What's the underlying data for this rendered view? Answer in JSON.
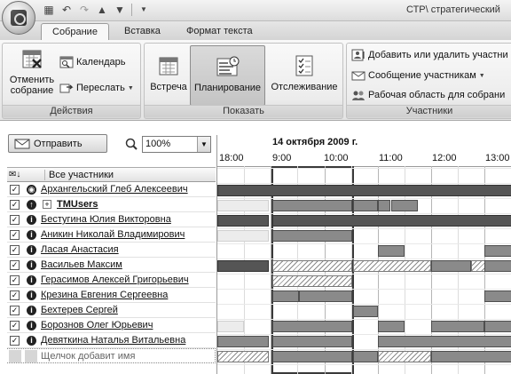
{
  "window": {
    "title": "СТР\\ стратегический"
  },
  "tabs": [
    {
      "label": "Собрание",
      "active": true
    },
    {
      "label": "Вставка",
      "active": false
    },
    {
      "label": "Формат текста",
      "active": false
    }
  ],
  "ribbon": {
    "actions": {
      "label": "Действия",
      "cancel_line1": "Отменить",
      "cancel_line2": "собрание",
      "calendar": "Календарь",
      "forward": "Переслать"
    },
    "show": {
      "label": "Показать",
      "meeting": "Встреча",
      "scheduling": "Планирование",
      "tracking": "Отслеживание"
    },
    "participants": {
      "label": "Участники",
      "add_remove": "Добавить или удалить участни",
      "message": "Сообщение участникам",
      "workspace": "Рабочая область для собрани"
    }
  },
  "toolbar": {
    "send": "Отправить",
    "zoom": "100%"
  },
  "schedule": {
    "date": "14 октября 2009 г.",
    "hours": [
      "18:00",
      "9:00",
      "10:00",
      "11:00",
      "12:00",
      "13:00"
    ],
    "column_header": "Все участники",
    "add_placeholder": "Щелчок добавит имя",
    "attendees": [
      {
        "name": "Архангельский Глеб Алексеевич",
        "role": "organizer",
        "checked": true
      },
      {
        "name": "TMUsers",
        "role": "required",
        "checked": true,
        "is_group": true
      },
      {
        "name": "Бестугина Юлия Викторовна",
        "role": "info",
        "checked": true
      },
      {
        "name": "Аникин Николай Владимирович",
        "role": "info",
        "checked": true
      },
      {
        "name": "Ласая Анастасия",
        "role": "info",
        "checked": true
      },
      {
        "name": "Васильев Максим",
        "role": "info",
        "checked": true
      },
      {
        "name": "Герасимов Алексей Григорьевич",
        "role": "info",
        "checked": true
      },
      {
        "name": "Крезина Евгения Сергеевна",
        "role": "info",
        "checked": true
      },
      {
        "name": "Бехтерев Сергей",
        "role": "info",
        "checked": true
      },
      {
        "name": "Борознов Олег Юрьевич",
        "role": "info",
        "checked": true
      },
      {
        "name": "Девяткина Наталья Витальевна",
        "role": "info",
        "checked": true
      }
    ]
  },
  "icons": {
    "checked_glyph": "✓",
    "expand_glyph": "+",
    "dropdown_glyph": "▼",
    "organizer_glyph": "◉",
    "required_glyph": "↑",
    "info_glyph": "i"
  }
}
